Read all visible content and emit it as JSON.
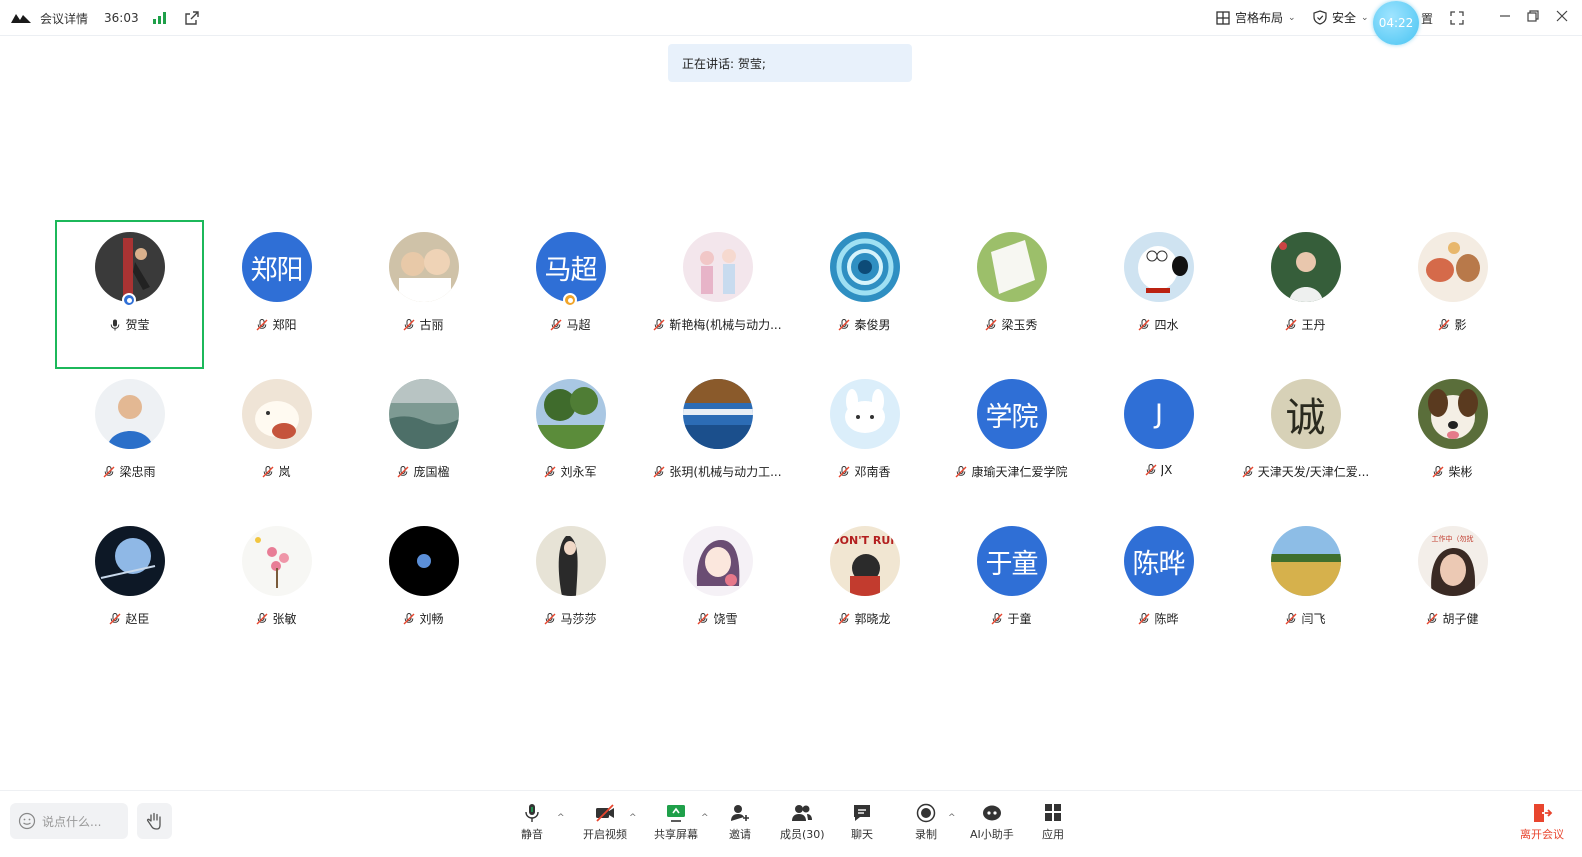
{
  "topbar": {
    "meeting_details": "会议详情",
    "timer": "36:03",
    "layout_label": "宫格布局",
    "security_label": "安全",
    "clock_bubble": "04:22",
    "settings_label": "置"
  },
  "speaking_banner": "正在讲话: 贺莹;",
  "participants": [
    {
      "name": "贺莹",
      "avatar_text": "",
      "mic": "on",
      "active": true,
      "badge": "host",
      "img": "martial"
    },
    {
      "name": "郑阳",
      "avatar_text": "郑阳",
      "mic": "muted"
    },
    {
      "name": "古丽",
      "avatar_text": "",
      "mic": "muted",
      "img": "kids"
    },
    {
      "name": "马超",
      "avatar_text": "马超",
      "mic": "muted",
      "badge": "cohost"
    },
    {
      "name": "靳艳梅(机械与动力...",
      "avatar_text": "",
      "mic": "muted",
      "img": "anime"
    },
    {
      "name": "秦俊男",
      "avatar_text": "",
      "mic": "muted",
      "img": "swirl"
    },
    {
      "name": "梁玉秀",
      "avatar_text": "",
      "mic": "muted",
      "img": "paper"
    },
    {
      "name": "四水",
      "avatar_text": "",
      "mic": "muted",
      "img": "dog-cartoon"
    },
    {
      "name": "王丹",
      "avatar_text": "",
      "mic": "muted",
      "img": "woman-tree"
    },
    {
      "name": "影",
      "avatar_text": "",
      "mic": "muted",
      "img": "animals"
    },
    {
      "name": "梁忠雨",
      "avatar_text": "",
      "mic": "muted",
      "img": "man-blue"
    },
    {
      "name": "岚",
      "avatar_text": "",
      "mic": "muted",
      "img": "bear"
    },
    {
      "name": "庞国楹",
      "avatar_text": "",
      "mic": "muted",
      "img": "sea"
    },
    {
      "name": "刘永军",
      "avatar_text": "",
      "mic": "muted",
      "img": "forest"
    },
    {
      "name": "张玥(机械与动力工...",
      "avatar_text": "",
      "mic": "muted",
      "img": "bridge"
    },
    {
      "name": "邓南香",
      "avatar_text": "",
      "mic": "muted",
      "img": "bunny"
    },
    {
      "name": "康瑜天津仁爱学院",
      "avatar_text": "学院",
      "mic": "muted"
    },
    {
      "name": "JX",
      "avatar_text": "J",
      "mic": "muted"
    },
    {
      "name": "天津天发/天津仁爱...",
      "avatar_text": "诚",
      "mic": "muted",
      "img": "calligraphy"
    },
    {
      "name": "柴彬",
      "avatar_text": "",
      "mic": "muted",
      "img": "puppy"
    },
    {
      "name": "赵臣",
      "avatar_text": "",
      "mic": "muted",
      "img": "moon"
    },
    {
      "name": "张敏",
      "avatar_text": "",
      "mic": "muted",
      "img": "flowers"
    },
    {
      "name": "刘畅",
      "avatar_text": "",
      "mic": "muted",
      "img": "black"
    },
    {
      "name": "马莎莎",
      "avatar_text": "",
      "mic": "muted",
      "img": "girl-painting"
    },
    {
      "name": "饶雪",
      "avatar_text": "",
      "mic": "muted",
      "img": "anime2"
    },
    {
      "name": "郭晓龙",
      "avatar_text": "",
      "mic": "muted",
      "img": "dont-run"
    },
    {
      "name": "于童",
      "avatar_text": "于童",
      "mic": "muted"
    },
    {
      "name": "陈晔",
      "avatar_text": "陈晔",
      "mic": "muted"
    },
    {
      "name": "闫飞",
      "avatar_text": "",
      "mic": "muted",
      "img": "field"
    },
    {
      "name": "胡子健",
      "avatar_text": "工作中（勿扰",
      "mic": "muted",
      "img": "face"
    }
  ],
  "bottombar": {
    "chat_placeholder": "说点什么...",
    "tools": {
      "mute": "静音",
      "video": "开启视频",
      "share": "共享屏幕",
      "invite": "邀请",
      "members": "成员(30)",
      "chat": "聊天",
      "record": "录制",
      "ai": "AI小助手",
      "apps": "应用"
    },
    "leave": "离开会议"
  },
  "colors": {
    "accent_blue": "#2f6fd6",
    "active_green": "#1cb85a",
    "leave_red": "#e8452e",
    "banner_bg": "#e8f1fb"
  }
}
